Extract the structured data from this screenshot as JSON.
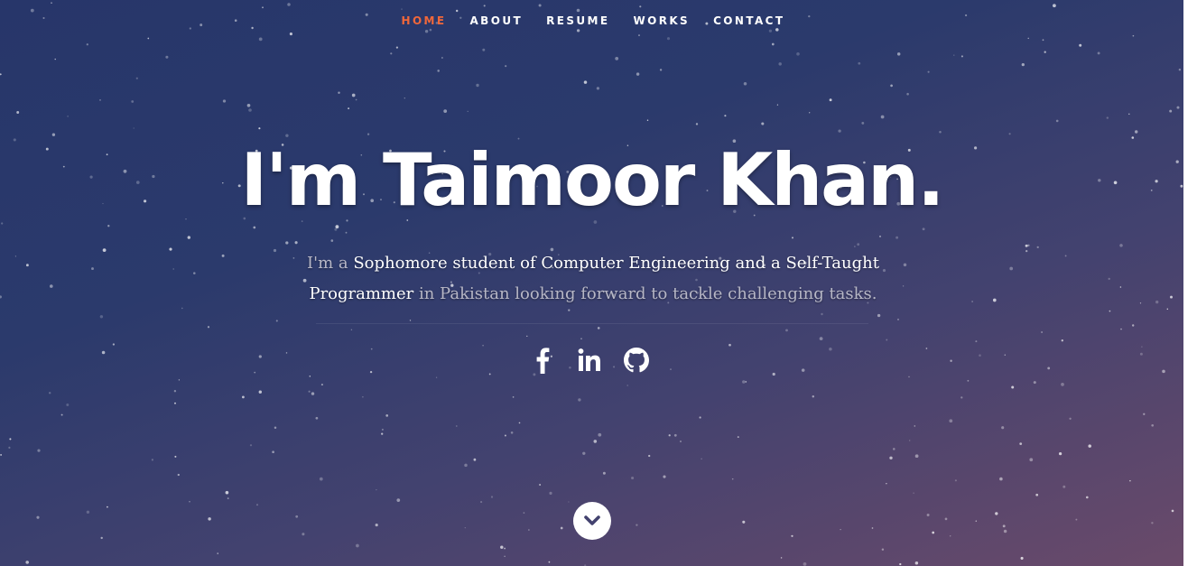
{
  "nav": {
    "items": [
      {
        "label": "HOME",
        "active": true
      },
      {
        "label": "ABOUT",
        "active": false
      },
      {
        "label": "RESUME",
        "active": false
      },
      {
        "label": "WORKS",
        "active": false
      },
      {
        "label": "CONTACT",
        "active": false
      }
    ]
  },
  "hero": {
    "title": "I'm Taimoor Khan.",
    "intro_1": "I'm a ",
    "highlight_1": "Sophomore student of Computer Engineering and a Self-Taught Programmer",
    "intro_2": " in Pakistan looking forward to tackle challenging tasks."
  },
  "social": {
    "icons": [
      "facebook-icon",
      "linkedin-icon",
      "github-icon"
    ]
  },
  "scroll_down": {
    "icon": "chevron-down-icon"
  },
  "colors": {
    "active_nav": "#f0673a",
    "background_top": "#27366a",
    "background_bottom": "#6a4a6a",
    "text_primary": "#ffffff",
    "text_muted": "#b7b7c6"
  }
}
